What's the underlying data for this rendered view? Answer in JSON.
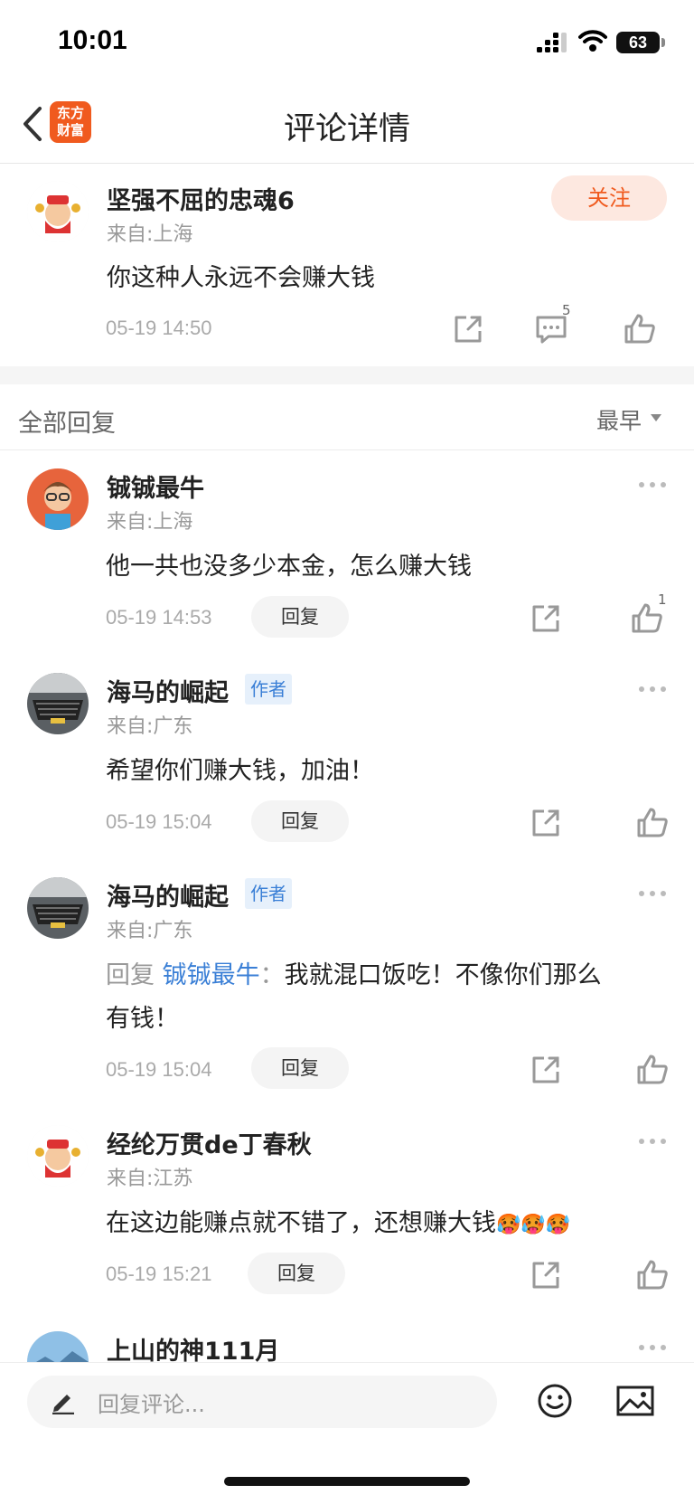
{
  "status": {
    "time": "10:01",
    "battery": "63"
  },
  "nav": {
    "title": "评论详情",
    "logo_line1": "东方",
    "logo_line2": "财富"
  },
  "main_comment": {
    "username": "坚强不屈的忠魂6",
    "from": "来自:上海",
    "text": "你这种人永远不会赚大钱",
    "date": "05-19 14:50",
    "follow_label": "关注",
    "comment_count": "5"
  },
  "replies_header": {
    "title": "全部回复",
    "sort": "最早"
  },
  "replies": [
    {
      "username": "铖铖最牛",
      "from": "来自:上海",
      "text": "他一共也没多少本金，怎么赚大钱",
      "date": "05-19 14:53",
      "reply_label": "回复",
      "likes": "1"
    },
    {
      "username": "海马的崛起",
      "tag": "作者",
      "from": "来自:广东",
      "text": "希望你们赚大钱，加油！",
      "date": "05-19 15:04",
      "reply_label": "回复"
    },
    {
      "username": "海马的崛起",
      "tag": "作者",
      "from": "来自:广东",
      "reply_prefix": "回复",
      "reply_to": "铖铖最牛",
      "colon": "：",
      "text_line1": "我就混口饭吃！不像你们那么",
      "text_line2": "有钱！",
      "date": "05-19 15:04",
      "reply_label": "回复"
    },
    {
      "username": "经纶万贯de丁春秋",
      "from": "来自:江苏",
      "text": "在这边能赚点就不错了，还想赚大钱",
      "emojis": "🥵🥵🥵",
      "date": "05-19 15:21",
      "reply_label": "回复"
    },
    {
      "username": "上山的神111月"
    }
  ],
  "bottom_bar": {
    "placeholder": "回复评论..."
  }
}
